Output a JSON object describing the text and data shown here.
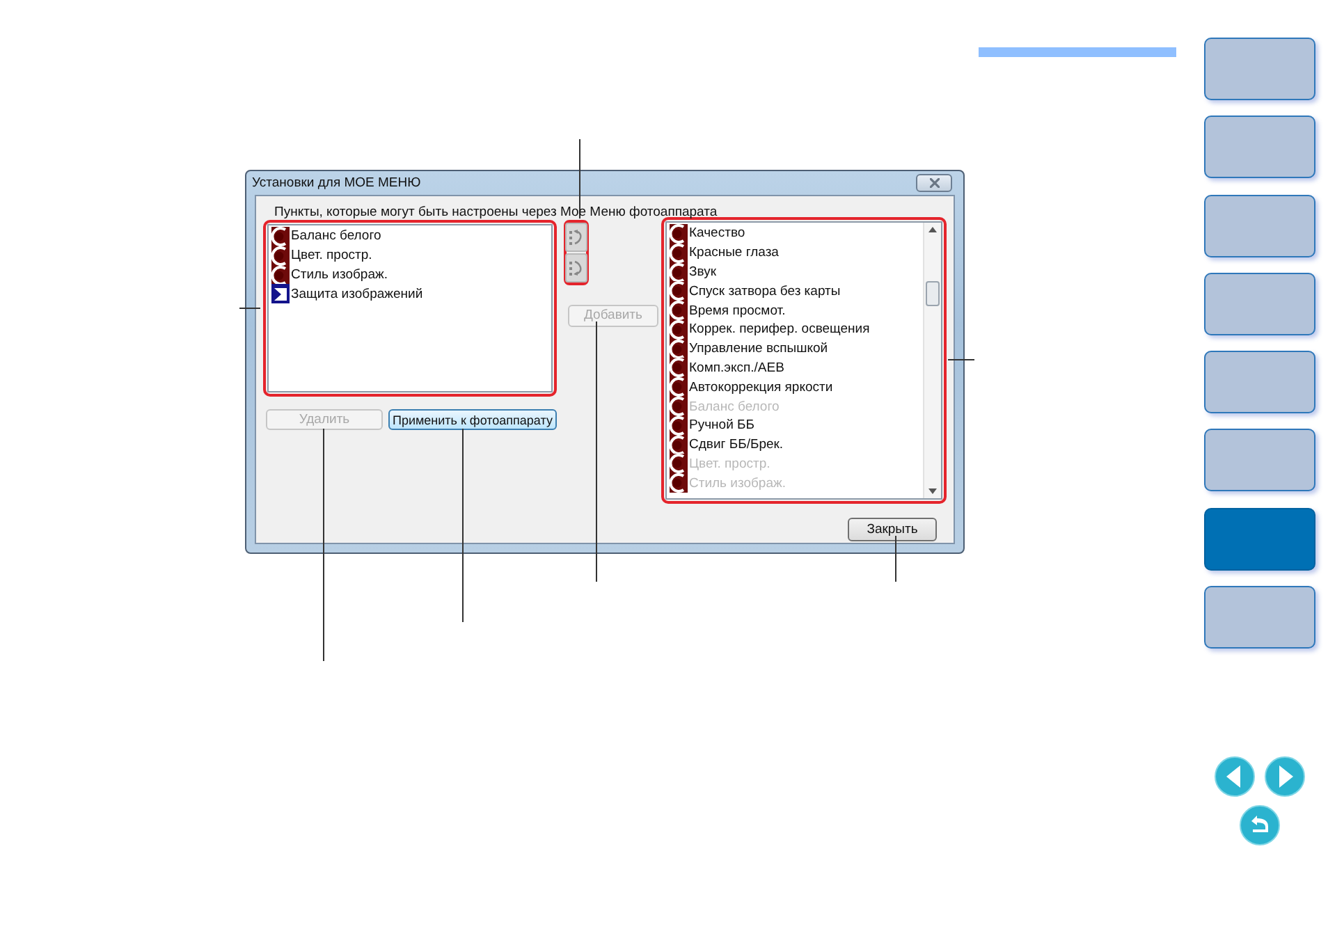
{
  "dialog": {
    "title": "Установки для МОЕ МЕНЮ",
    "caption": "Пункты, которые могут быть настроены через Мое Меню фотоаппарата",
    "my_menu_items": [
      {
        "label": "Баланс белого",
        "kind": "camera",
        "disabled": false
      },
      {
        "label": "Цвет. простр.",
        "kind": "camera",
        "disabled": false
      },
      {
        "label": "Стиль изображ.",
        "kind": "camera",
        "disabled": false
      },
      {
        "label": "Защита изображений",
        "kind": "playback",
        "disabled": false
      }
    ],
    "move_buttons": [
      {
        "kind": "up",
        "disabled": true
      },
      {
        "kind": "down",
        "disabled": true
      }
    ],
    "add_button": {
      "label": "Добавить",
      "disabled": true
    },
    "available_items": [
      {
        "label": "Качество",
        "kind": "camera",
        "disabled": false
      },
      {
        "label": "Красные глаза",
        "kind": "camera",
        "disabled": false
      },
      {
        "label": "Звук",
        "kind": "camera",
        "disabled": false
      },
      {
        "label": "Спуск затвора без карты",
        "kind": "camera",
        "disabled": false
      },
      {
        "label": "Время просмот.",
        "kind": "camera",
        "disabled": false
      },
      {
        "label": "Коррек. перифер. освещения",
        "kind": "camera",
        "disabled": false
      },
      {
        "label": "Управление вспышкой",
        "kind": "camera",
        "disabled": false
      },
      {
        "label": "Комп.эксп./AEB",
        "kind": "camera",
        "disabled": false
      },
      {
        "label": "Автокоррекция яркости",
        "kind": "camera",
        "disabled": false
      },
      {
        "label": "Баланс белого",
        "kind": "camera",
        "disabled": true
      },
      {
        "label": "Ручной ББ",
        "kind": "camera",
        "disabled": false
      },
      {
        "label": "Сдвиг ББ/Брек.",
        "kind": "camera",
        "disabled": false
      },
      {
        "label": "Цвет. простр.",
        "kind": "camera",
        "disabled": true
      },
      {
        "label": "Стиль изображ.",
        "kind": "camera",
        "disabled": true
      }
    ],
    "delete_button": {
      "label": "Удалить",
      "disabled": true
    },
    "apply_button": {
      "label": "Применить к фотоаппарату",
      "disabled": false
    },
    "close_button": {
      "label": "Закрыть",
      "disabled": false
    }
  },
  "nav_tabs": [
    {
      "selected": false
    },
    {
      "selected": false
    },
    {
      "selected": false
    },
    {
      "selected": false
    },
    {
      "selected": false
    },
    {
      "selected": false
    },
    {
      "selected": true
    },
    {
      "selected": false
    }
  ]
}
